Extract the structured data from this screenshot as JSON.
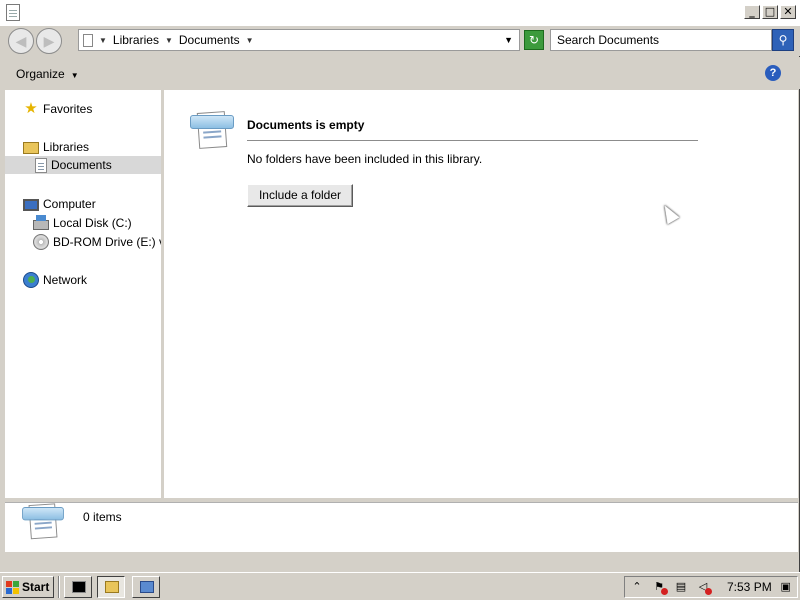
{
  "window": {
    "title": "",
    "controls": {
      "minimize": "_",
      "maximize": "□",
      "close": "✕"
    }
  },
  "address_bar": {
    "breadcrumbs": [
      "Libraries",
      "Documents"
    ],
    "search_placeholder": "Search Documents"
  },
  "command_bar": {
    "organize_label": "Organize",
    "help_label": "?"
  },
  "nav_pane": {
    "favorites": "Favorites",
    "libraries": "Libraries",
    "documents": "Documents",
    "computer": "Computer",
    "local_disk": "Local Disk (C:)",
    "bd_rom": "BD-ROM Drive (E:) virt",
    "network": "Network"
  },
  "content": {
    "empty_title": "Documents is empty",
    "empty_message": "No folders have been included in this library.",
    "include_button": "Include a folder"
  },
  "details_pane": {
    "item_count": "0 items"
  },
  "taskbar": {
    "start_label": "Start",
    "clock": "7:53 PM",
    "colors": {
      "logo_red": "#e03a1e",
      "logo_green": "#3aa63a",
      "logo_blue": "#2a6ad0",
      "logo_yellow": "#f2c200"
    }
  }
}
